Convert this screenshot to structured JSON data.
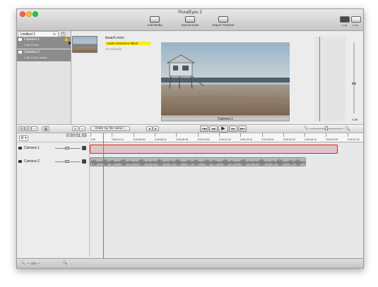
{
  "window": {
    "title": "PluralEyes 3"
  },
  "toolbar": {
    "add_media": "Add Media",
    "synchronize": "Synchronize",
    "export_timeline": "Export Timeline",
    "layout_1up": "1-up",
    "layout_2up": "2-up"
  },
  "project": {
    "tab_label": "Untitled 1",
    "cameras": [
      {
        "name": "Camera 1",
        "detail": "1 file      15 fps",
        "warning": true
      },
      {
        "name": "Camera 2",
        "detail": "1 file      24 fps   media",
        "warning": false
      }
    ]
  },
  "clip_info": {
    "filename": "beach.mov",
    "error": "Audio extraction failed",
    "duration": "18 seconds"
  },
  "preview": {
    "caption": "Camera 1"
  },
  "meter": {
    "db_label": "0 dB"
  },
  "controls": {
    "add": "+",
    "remove": "−",
    "order": "Order by file name ↕",
    "prev": "◂",
    "next": "▸",
    "transport": [
      "▪◂◂",
      "◂◂",
      "▶",
      "▸▸",
      "▸▸▪"
    ],
    "zoom_out_icon": "🔍",
    "zoom_in_icon": "🔍"
  },
  "timeline": {
    "gear_label": "⚙ ▾",
    "timecode": "0:00:01.03",
    "ruler_labels": [
      "0:00",
      "0:00:01.01",
      "0:00:05.00",
      "0:00:06.21",
      "0:00:08.16",
      "0:00:10.00",
      "0:00:11.20",
      "0:00:13.10",
      "0:00:15.00",
      "0:00:16.20",
      "0:00:18.10",
      "0:00:20.00",
      "0:00:21.20"
    ],
    "tracks": [
      {
        "name": "Camera 1"
      },
      {
        "name": "Camera 2"
      }
    ]
  },
  "status": {
    "zoom_label": "— 101 —"
  }
}
